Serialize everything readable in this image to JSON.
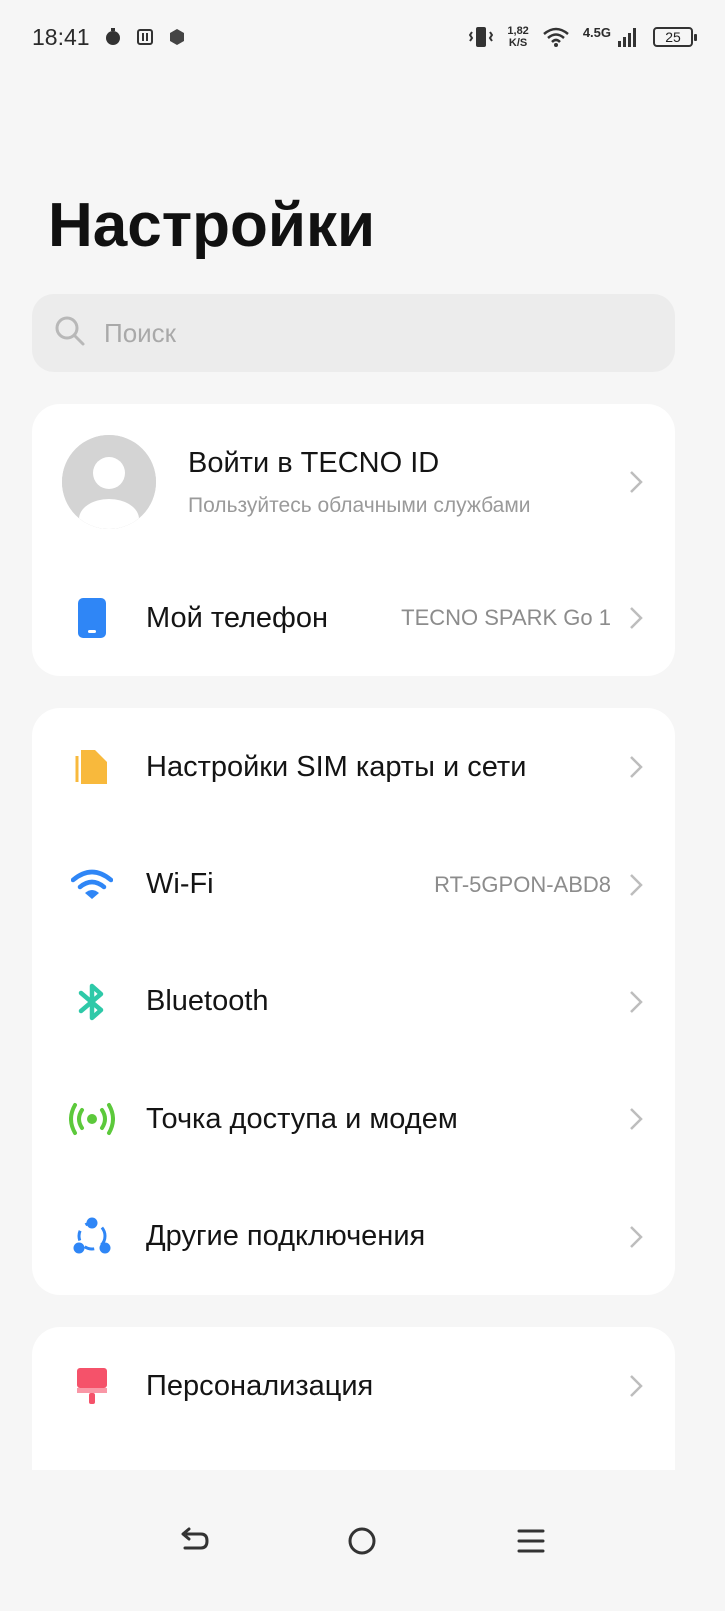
{
  "status_bar": {
    "time": "18:41",
    "speed_value": "1,82",
    "speed_unit": "K/S",
    "network_type": "4.5G",
    "battery_level": "25"
  },
  "page": {
    "title": "Настройки"
  },
  "search": {
    "placeholder": "Поиск"
  },
  "account": {
    "title": "Войти в TECNO ID",
    "subtitle": "Пользуйтесь облачными службами"
  },
  "my_phone": {
    "label": "Мой телефон",
    "value": "TECNO SPARK Go 1"
  },
  "connections": {
    "sim": {
      "label": "Настройки SIM карты и сети"
    },
    "wifi": {
      "label": "Wi-Fi",
      "value": "RT-5GPON-ABD8"
    },
    "bluetooth": {
      "label": "Bluetooth"
    },
    "hotspot": {
      "label": "Точка доступа и модем"
    },
    "other": {
      "label": "Другие подключения"
    }
  },
  "personalization": {
    "label": "Персонализация"
  },
  "colors": {
    "phone_icon": "#2f86f6",
    "sim_icon": "#f8b93c",
    "wifi_icon": "#2f86f6",
    "bluetooth_icon": "#2ec9a8",
    "hotspot_icon": "#5cc93b",
    "other_icon": "#2f86f6",
    "personalization_icon": "#f5526a"
  }
}
